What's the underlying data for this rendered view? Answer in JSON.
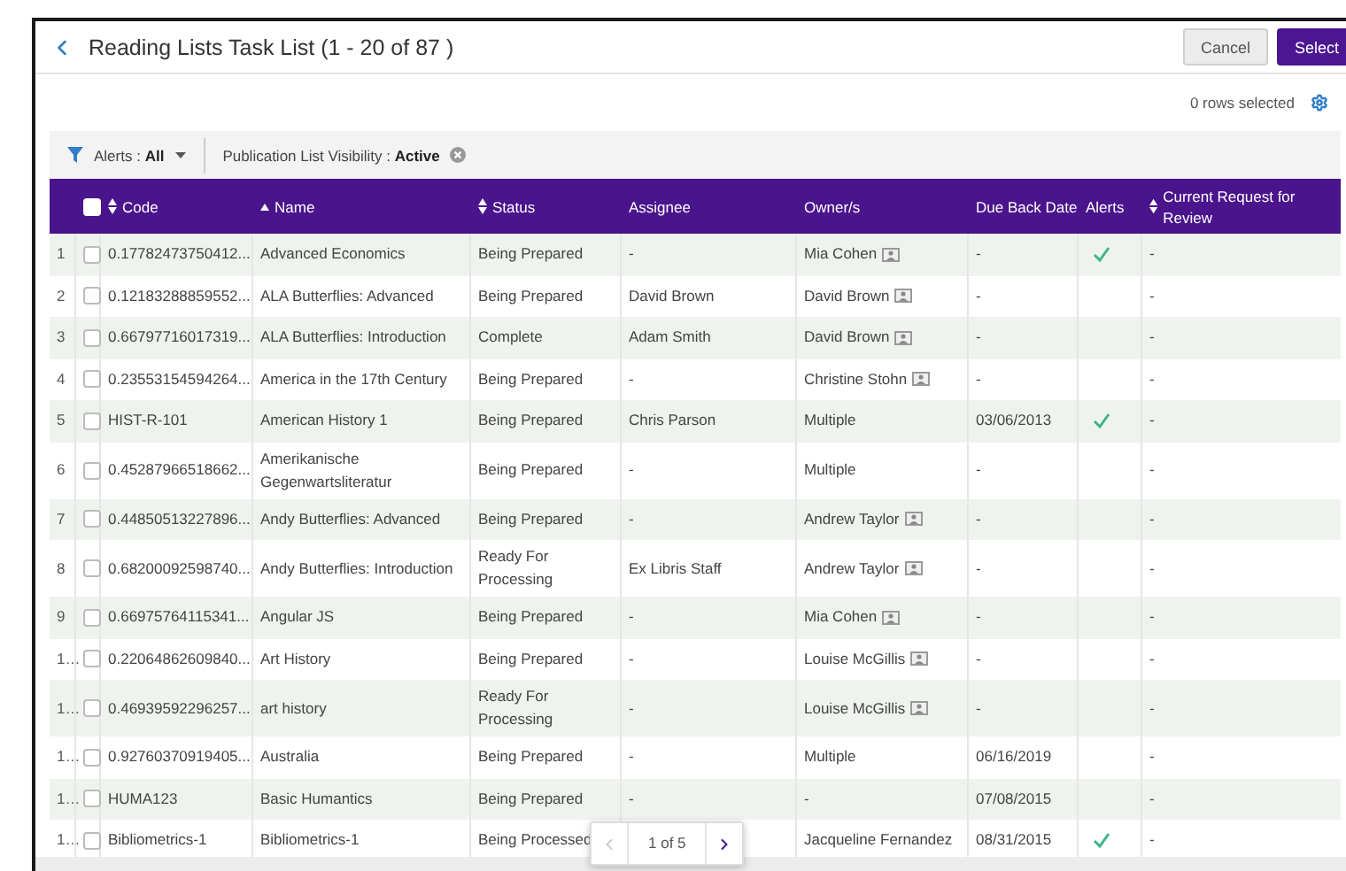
{
  "header": {
    "title": "Reading Lists Task List (1 - 20 of 87 )",
    "buttons": [
      {
        "label": "Cancel",
        "kind": "secondary"
      },
      {
        "label": "Select",
        "kind": "primary"
      }
    ]
  },
  "rows_selected": "0 rows selected",
  "filters": [
    {
      "label": "Alerts : ",
      "value": "All",
      "kind": "dropdown"
    },
    {
      "label": "Publication List Visibility : ",
      "value": "Active",
      "kind": "removable"
    }
  ],
  "table": {
    "select_all": {
      "checked": false
    },
    "columns": [
      {
        "label": "Code",
        "sortable": true,
        "sorted": false
      },
      {
        "label": "Name",
        "sortable": true,
        "sorted": true
      },
      {
        "label": "Status",
        "sortable": true,
        "sorted": false
      },
      {
        "label": "Assignee",
        "sortable": false,
        "sorted": false
      },
      {
        "label": "Owner/s",
        "sortable": false,
        "sorted": false
      },
      {
        "label": "Due Back Date",
        "sortable": false,
        "sorted": false
      },
      {
        "label": "Alerts",
        "sortable": false,
        "sorted": false
      },
      {
        "label": "Current Request for Review",
        "sortable": true,
        "sorted": false
      }
    ],
    "rows": [
      {
        "num": "1",
        "selected": false,
        "code": "0.17782473750412...",
        "name": "Advanced Economics",
        "status": "Being Prepared",
        "assignee": "-",
        "owner": "Mia Cohen",
        "owner_card": true,
        "due": "-",
        "alert": true,
        "current": "-"
      },
      {
        "num": "2",
        "selected": false,
        "code": "0.12183288859552...",
        "name": "ALA Butterflies: Advanced",
        "status": "Being Prepared",
        "assignee": "David Brown",
        "owner": "David Brown",
        "owner_card": true,
        "due": "-",
        "alert": false,
        "current": "-"
      },
      {
        "num": "3",
        "selected": false,
        "code": "0.66797716017319...",
        "name": "ALA Butterflies: Introduction",
        "status": "Complete",
        "assignee": "Adam Smith",
        "owner": "David Brown",
        "owner_card": true,
        "due": "-",
        "alert": false,
        "current": "-"
      },
      {
        "num": "4",
        "selected": false,
        "code": "0.23553154594264...",
        "name": "America in the 17th Century",
        "status": "Being Prepared",
        "assignee": "-",
        "owner": "Christine Stohn",
        "owner_card": true,
        "due": "-",
        "alert": false,
        "current": "-"
      },
      {
        "num": "5",
        "selected": false,
        "code": "HIST-R-101",
        "name": "American History 1",
        "status": "Being Prepared",
        "assignee": "Chris Parson",
        "owner": "Multiple",
        "owner_card": false,
        "due": "03/06/2013",
        "alert": true,
        "current": "-"
      },
      {
        "num": "6",
        "selected": false,
        "code": "0.45287966518662...",
        "name": "Amerikanische Gegenwartsliteratur",
        "status": "Being Prepared",
        "assignee": "-",
        "owner": "Multiple",
        "owner_card": false,
        "due": "-",
        "alert": false,
        "current": "-"
      },
      {
        "num": "7",
        "selected": false,
        "code": "0.44850513227896...",
        "name": "Andy Butterflies: Advanced",
        "status": "Being Prepared",
        "assignee": "-",
        "owner": "Andrew Taylor",
        "owner_card": true,
        "due": "-",
        "alert": false,
        "current": "-"
      },
      {
        "num": "8",
        "selected": false,
        "code": "0.68200092598740...",
        "name": "Andy Butterflies: Introduction",
        "status": "Ready For Processing",
        "assignee": "Ex Libris Staff",
        "owner": "Andrew Taylor",
        "owner_card": true,
        "due": "-",
        "alert": false,
        "current": "-"
      },
      {
        "num": "9",
        "selected": false,
        "code": "0.66975764115341...",
        "name": "Angular JS",
        "status": "Being Prepared",
        "assignee": "-",
        "owner": "Mia Cohen",
        "owner_card": true,
        "due": "-",
        "alert": false,
        "current": "-"
      },
      {
        "num": "1…",
        "selected": false,
        "code": "0.22064862609840...",
        "name": "Art History",
        "status": "Being Prepared",
        "assignee": "-",
        "owner": "Louise McGillis",
        "owner_card": true,
        "due": "-",
        "alert": false,
        "current": "-"
      },
      {
        "num": "1…",
        "selected": false,
        "code": "0.46939592296257...",
        "name": "art history",
        "status": "Ready For Processing",
        "assignee": "-",
        "owner": "Louise McGillis",
        "owner_card": true,
        "due": "-",
        "alert": false,
        "current": "-"
      },
      {
        "num": "1…",
        "selected": false,
        "code": "0.92760370919405...",
        "name": "Australia",
        "status": "Being Prepared",
        "assignee": "-",
        "owner": "Multiple",
        "owner_card": false,
        "due": "06/16/2019",
        "alert": false,
        "current": "-"
      },
      {
        "num": "1…",
        "selected": false,
        "code": "HUMA123",
        "name": "Basic Humantics",
        "status": "Being Prepared",
        "assignee": "-",
        "owner": "-",
        "owner_card": false,
        "due": "07/08/2015",
        "alert": false,
        "current": "-"
      },
      {
        "num": "1…",
        "selected": false,
        "code": "Bibliometrics-1",
        "name": "Bibliometrics-1",
        "status": "Being Processed",
        "owner": "Jacqueline Fernandez",
        "owner_card": false,
        "due": "08/31/2015",
        "alert": true,
        "current": "-"
      }
    ]
  },
  "pagination": {
    "prev_disabled": true,
    "label": "1 of 5",
    "next_disabled": false
  }
}
